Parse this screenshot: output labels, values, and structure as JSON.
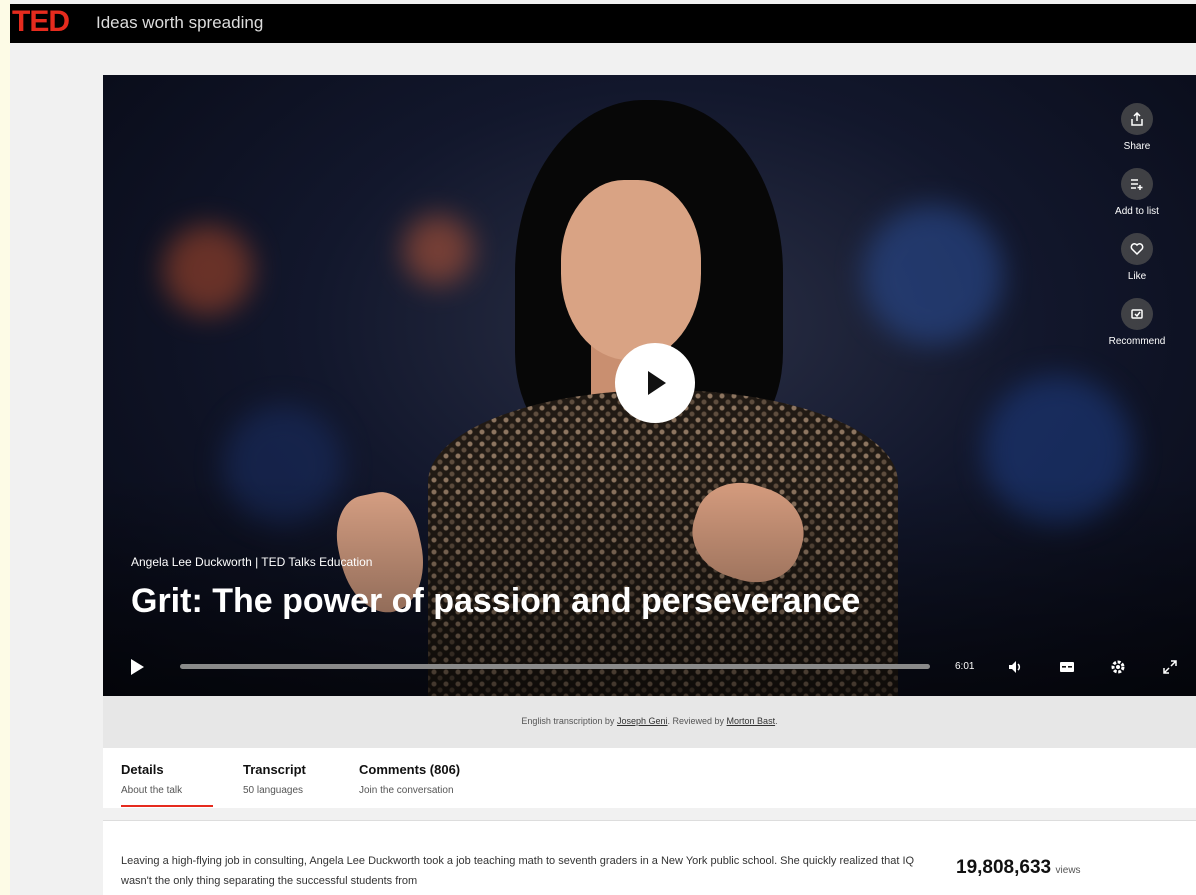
{
  "header": {
    "logo": "TED",
    "tagline": "Ideas worth spreading"
  },
  "video": {
    "actions": [
      {
        "label": "Share",
        "icon": "share-icon"
      },
      {
        "label": "Add to list",
        "icon": "add-to-list-icon"
      },
      {
        "label": "Like",
        "icon": "heart-icon"
      },
      {
        "label": "Recommend",
        "icon": "recommend-icon"
      }
    ],
    "speaker_line": "Angela Lee Duckworth | TED Talks Education",
    "title": "Grit: The power of passion and perseverance",
    "duration": "6:01",
    "progress": 0
  },
  "credits": {
    "prefix": "English transcription by",
    "transcriber": "Joseph Geni",
    "middle": ". Reviewed by",
    "reviewer": "Morton Bast",
    "suffix": "."
  },
  "tabs": [
    {
      "label": "Details",
      "sub": "About the talk"
    },
    {
      "label": "Transcript",
      "sub": "50 languages"
    },
    {
      "label": "Comments (806)",
      "sub": "Join the conversation"
    }
  ],
  "description": "Leaving a high-flying job in consulting, Angela Lee Duckworth took a job teaching math to seventh graders in a New York public school. She quickly realized that IQ wasn't the only thing separating the successful students from",
  "stats": {
    "views": "19,808,633",
    "views_label": "views"
  },
  "colors": {
    "brand_red": "#e62b1e",
    "topbar": "#000000"
  }
}
